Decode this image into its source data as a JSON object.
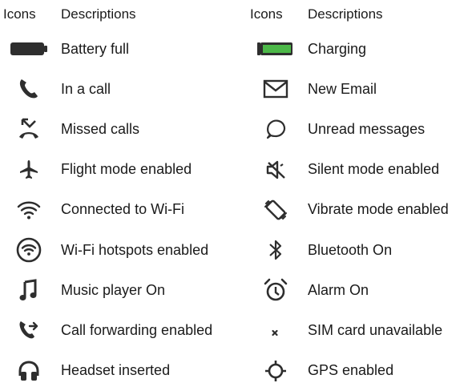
{
  "headers": {
    "left_icons": "Icons",
    "left_descriptions": "Descriptions",
    "right_icons": "Icons",
    "right_descriptions": "Descriptions"
  },
  "rows": [
    {
      "left": {
        "icon": "battery-full-icon",
        "label": "Battery full"
      },
      "right": {
        "icon": "battery-charging-icon",
        "label": "Charging"
      }
    },
    {
      "left": {
        "icon": "phone-call-icon",
        "label": "In a call"
      },
      "right": {
        "icon": "email-icon",
        "label": "New Email"
      }
    },
    {
      "left": {
        "icon": "missed-call-icon",
        "label": "Missed calls"
      },
      "right": {
        "icon": "message-bubble-icon",
        "label": "Unread messages"
      }
    },
    {
      "left": {
        "icon": "airplane-icon",
        "label": "Flight mode enabled"
      },
      "right": {
        "icon": "speaker-muted-icon",
        "label": "Silent mode enabled"
      }
    },
    {
      "left": {
        "icon": "wifi-icon",
        "label": "Connected to Wi-Fi"
      },
      "right": {
        "icon": "vibrate-icon",
        "label": "Vibrate mode enabled"
      }
    },
    {
      "left": {
        "icon": "wifi-hotspot-icon",
        "label": "Wi-Fi hotspots enabled"
      },
      "right": {
        "icon": "bluetooth-icon",
        "label": "Bluetooth On"
      }
    },
    {
      "left": {
        "icon": "music-note-icon",
        "label": "Music player On"
      },
      "right": {
        "icon": "alarm-clock-icon",
        "label": "Alarm On"
      }
    },
    {
      "left": {
        "icon": "call-forward-icon",
        "label": "Call forwarding enabled"
      },
      "right": {
        "icon": "sim-unavailable-icon",
        "label": "SIM card unavailable"
      }
    },
    {
      "left": {
        "icon": "headset-icon",
        "label": "Headset inserted"
      },
      "right": {
        "icon": "gps-icon",
        "label": "GPS enabled"
      }
    }
  ],
  "colors": {
    "icon": "#2e2e2e",
    "charging_fill": "#4cb848",
    "text": "#1a1a1a"
  }
}
